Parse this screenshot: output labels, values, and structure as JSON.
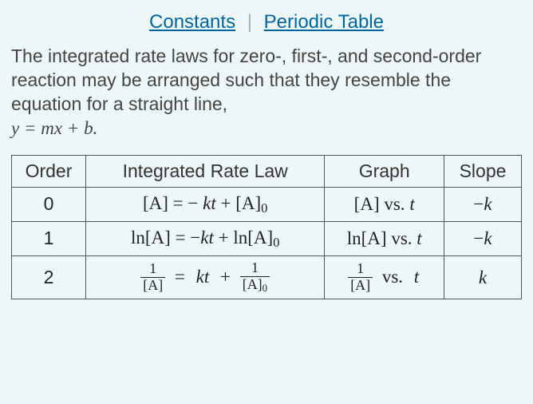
{
  "links": {
    "constants": "Constants",
    "separator": "|",
    "periodic_table": "Periodic Table"
  },
  "intro": {
    "text": "The integrated rate laws for zero-, first-, and second-order reaction may be arranged such that they resemble the equation for a straight line,",
    "equation": "y = mx + b."
  },
  "table": {
    "headers": {
      "order": "Order",
      "law": "Integrated Rate Law",
      "graph": "Graph",
      "slope": "Slope"
    },
    "rows": [
      {
        "order": "0",
        "law": "[A] = − kt + [A]₀",
        "graph": "[A] vs. t",
        "slope": "−k"
      },
      {
        "order": "1",
        "law": "ln[A] = −kt + ln[A]₀",
        "graph": "ln[A] vs. t",
        "slope": "−k"
      },
      {
        "order": "2",
        "law": "1/[A] = kt + 1/[A]₀",
        "graph": "1/[A] vs. t",
        "slope": "k"
      }
    ]
  }
}
